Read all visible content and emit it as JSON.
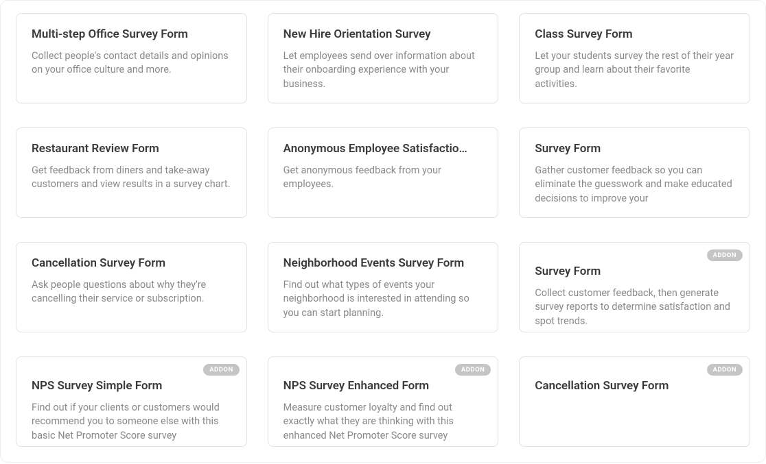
{
  "addon_label": "ADDON",
  "cards": [
    {
      "title": "Multi-step Office Survey Form",
      "desc": "Collect people's contact details and opinions on your office culture and more.",
      "addon": false
    },
    {
      "title": "New Hire Orientation Survey",
      "desc": "Let employees send over information about their onboarding experience with your business.",
      "addon": false
    },
    {
      "title": "Class Survey Form",
      "desc": "Let your students survey the rest of their year group and learn about their favorite activities.",
      "addon": false
    },
    {
      "title": "Restaurant Review Form",
      "desc": "Get feedback from diners and take-away customers and view results in a survey chart.",
      "addon": false
    },
    {
      "title": "Anonymous Employee Satisfactio…",
      "desc": "Get anonymous feedback from your employees.",
      "addon": false
    },
    {
      "title": "Survey Form",
      "desc": "Gather customer feedback so you can eliminate the guesswork and make educated decisions to improve your",
      "addon": false
    },
    {
      "title": "Cancellation Survey Form",
      "desc": "Ask people questions about why they're cancelling their service or subscription.",
      "addon": false
    },
    {
      "title": "Neighborhood Events Survey Form",
      "desc": "Find out what types of events your neighborhood is interested in attending so you can start planning.",
      "addon": false
    },
    {
      "title": "Survey Form",
      "desc": "Collect customer feedback, then generate survey reports to determine satisfaction and spot trends.",
      "addon": true
    },
    {
      "title": "NPS Survey Simple Form",
      "desc": "Find out if your clients or customers would recommend you to someone else with this basic Net Promoter Score survey",
      "addon": true
    },
    {
      "title": "NPS Survey Enhanced Form",
      "desc": "Measure customer loyalty and find out exactly what they are thinking with this enhanced Net Promoter Score survey",
      "addon": true
    },
    {
      "title": "Cancellation Survey Form",
      "desc": "",
      "addon": true
    }
  ]
}
